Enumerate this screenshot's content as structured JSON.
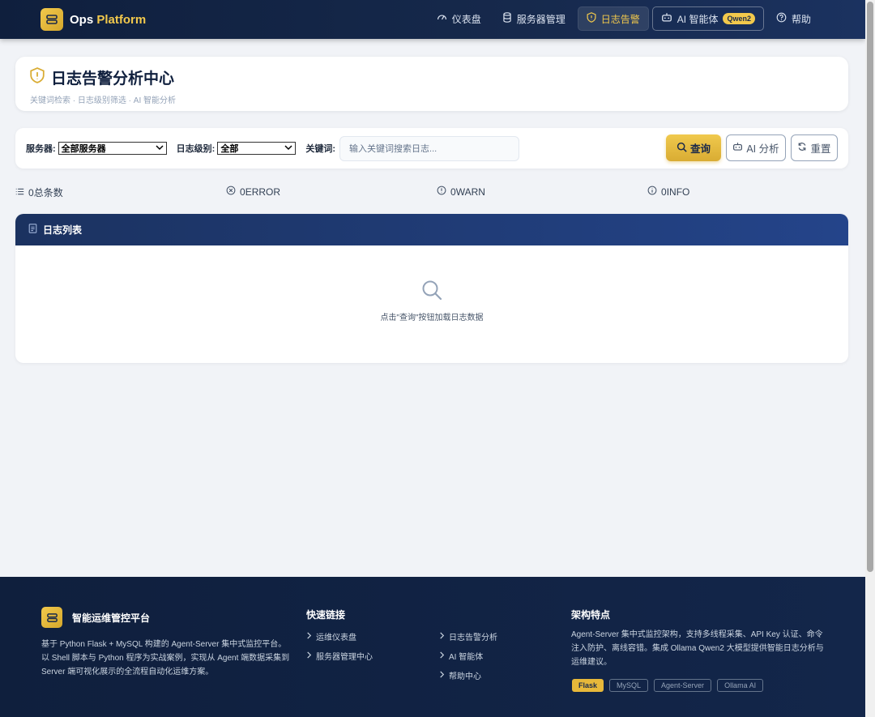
{
  "navbar": {
    "brand_main": "Ops ",
    "brand_accent": "Platform",
    "links": [
      {
        "label": "仪表盘",
        "icon": "gauge-icon"
      },
      {
        "label": "服务器管理",
        "icon": "database-icon"
      },
      {
        "label": "日志告警",
        "icon": "shield-icon"
      },
      {
        "label": "AI 智能体",
        "icon": "robot-icon"
      },
      {
        "label": "帮助",
        "icon": "help-circle-icon"
      }
    ],
    "qwen_badge": "Qwen2"
  },
  "header": {
    "title": "日志告警分析中心",
    "subtitle": "关键词检索 · 日志级别筛选 · AI 智能分析"
  },
  "filters": {
    "server_label": "服务器:",
    "server_value": "全部服务器",
    "level_label": "日志级别:",
    "level_value": "全部",
    "keyword_label": "关键词:",
    "keyword_placeholder": "输入关键词搜索日志..."
  },
  "buttons": {
    "query": "查询",
    "ai_analyze": "AI 分析",
    "reset": "重置"
  },
  "stats": [
    {
      "count": "0",
      "label": "总条数",
      "icon": "list-icon"
    },
    {
      "count": "0",
      "label": "ERROR",
      "icon": "x-circle-icon"
    },
    {
      "count": "0",
      "label": "WARN",
      "icon": "alert-circle-icon"
    },
    {
      "count": "0",
      "label": "INFO",
      "icon": "info-circle-icon"
    }
  ],
  "log_list": {
    "title": "日志列表",
    "empty_text": "点击\"查询\"按钮加载日志数据"
  },
  "footer": {
    "brand": "智能运维管控平台",
    "description": "基于 Python Flask + MySQL 构建的 Agent-Server 集中式监控平台。以 Shell 脚本与 Python 程序为实战案例，实现从 Agent 端数据采集到 Server 端可视化展示的全流程自动化运维方案。",
    "quick_links_title": "快速链接",
    "quick_links": [
      "运维仪表盘",
      "服务器管理中心",
      "日志告警分析",
      "AI 智能体",
      "帮助中心"
    ],
    "arch_title": "架构特点",
    "arch_desc": "Agent-Server 集中式监控架构，支持多线程采集、API Key 认证、命令注入防护、离线容错。集成 Ollama Qwen2 大模型提供智能日志分析与运维建议。",
    "tags": [
      "Flask",
      "MySQL",
      "Agent-Server",
      "Ollama AI"
    ]
  },
  "colors": {
    "accent": "#f2c94c",
    "navy": "#0f1f3d",
    "panel_header": "#1b3260"
  }
}
